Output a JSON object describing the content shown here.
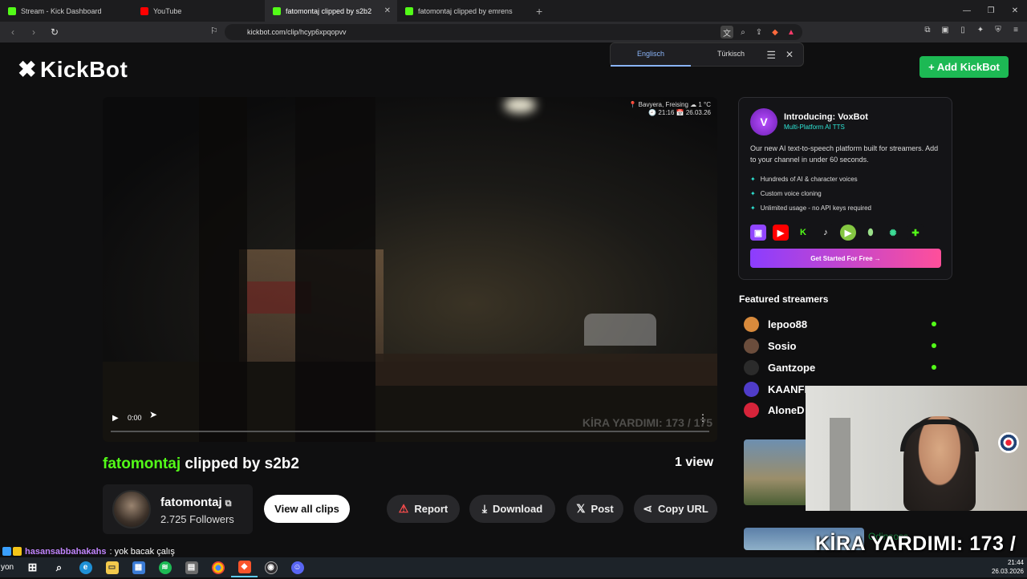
{
  "browser": {
    "tabs": [
      {
        "label": "Stream - Kick Dashboard",
        "favicon_color": "#53fc18"
      },
      {
        "label": "YouTube",
        "favicon_color": "#ff0000"
      },
      {
        "label": "fatomontaj clipped by s2b2",
        "favicon_color": "#53fc18"
      },
      {
        "label": "fatomontaj clipped by emrens",
        "favicon_color": "#53fc18"
      }
    ],
    "url": "kickbot.com/clip/hcyp6xpqopvv"
  },
  "translate": {
    "lang_from": "Englisch",
    "lang_to": "Türkisch"
  },
  "site": {
    "logo": "KickBot",
    "add_button": "+ Add KickBot",
    "accent": "#53fc18"
  },
  "video": {
    "location": "📍 Bavyera, Freising ☁ 1 °C",
    "datetime": "🕘 21:16 📅 26.03.26",
    "time": "0:00",
    "overlay": "KİRA YARDIMI: 173 / 175"
  },
  "clip": {
    "channel": "fatomontaj",
    "clipped_by": "clipped by s2b2",
    "views": "1 view",
    "followers": "2.725 Followers",
    "view_all": "View all clips",
    "actions": {
      "report": "Report",
      "download": "Download",
      "post": "Post",
      "copy": "Copy URL"
    }
  },
  "promo": {
    "title": "Introducing: VoxBot",
    "subtitle": "Multi-Platform AI TTS",
    "description": "Our new AI text-to-speech platform built for streamers. Add to your channel in under 60 seconds.",
    "features": [
      "Hundreds of AI & character voices",
      "Custom voice cloning",
      "Unlimited usage - no API keys required"
    ],
    "cta": "Get Started For Free →"
  },
  "featured": {
    "title": "Featured streamers",
    "streamers": [
      {
        "name": "lepoo88",
        "live": true
      },
      {
        "name": "Sosio",
        "live": true
      },
      {
        "name": "Gantzope",
        "live": true
      },
      {
        "name": "KAANFLIX",
        "live": false
      },
      {
        "name": "AloneD",
        "live": false
      }
    ],
    "thumb_text": "Odinsoss"
  },
  "overlay": {
    "kira": "KİRA YARDIMI:  173 / 175"
  },
  "chat": {
    "user": "hasansabbahakahs",
    "message": ": yok bacak çalış"
  },
  "taskbar": {
    "label": "yon",
    "time": "21:44",
    "date": "26.03.2026"
  }
}
